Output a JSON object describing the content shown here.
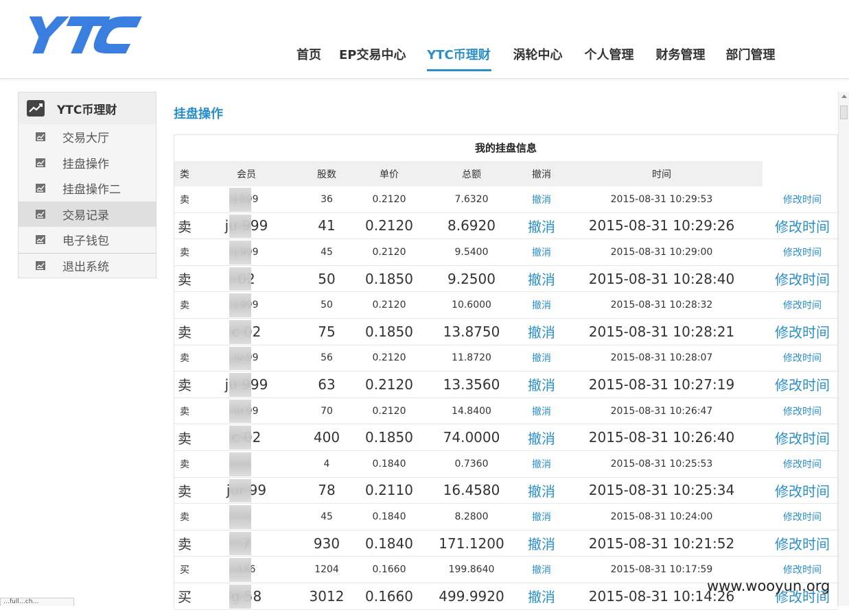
{
  "logo": {
    "text": "YTC"
  },
  "nav": [
    {
      "label": "首页",
      "active": false
    },
    {
      "label": "EP交易中心",
      "active": false
    },
    {
      "label": "YTC币理财",
      "active": true
    },
    {
      "label": "涡轮中心",
      "active": false
    },
    {
      "label": "个人管理",
      "active": false
    },
    {
      "label": "财务管理",
      "active": false
    },
    {
      "label": "部门管理",
      "active": false
    }
  ],
  "sidebar": {
    "title": "YTC币理财",
    "items": [
      {
        "label": "交易大厅"
      },
      {
        "label": "挂盘操作"
      },
      {
        "label": "挂盘操作二"
      },
      {
        "label": "交易记录"
      },
      {
        "label": "电子钱包"
      },
      {
        "label": "退出系统"
      }
    ]
  },
  "section_title": "挂盘操作",
  "table": {
    "caption": "我的挂盘信息",
    "headers": {
      "type": "类",
      "member": "会员",
      "shares": "股数",
      "price": "单价",
      "total": "总额",
      "cancel": "撤消",
      "time": "时间"
    },
    "rows": [
      {
        "type": "卖",
        "member": "j 999",
        "shares": "36",
        "price": "0.2120",
        "total": "7.6320",
        "cancel": "撤消",
        "time": "2015-08-31 10:29:53",
        "modify": "修改时间",
        "size": "small"
      },
      {
        "type": "卖",
        "member": "ju 999",
        "shares": "41",
        "price": "0.2120",
        "total": "8.6920",
        "cancel": "撤消",
        "time": "2015-08-31 10:29:26",
        "modify": "修改时间",
        "size": "big"
      },
      {
        "type": "卖",
        "member": "j 999",
        "shares": "45",
        "price": "0.2120",
        "total": "9.5400",
        "cancel": "撤消",
        "time": "2015-08-31 10:29:00",
        "modify": "修改时间",
        "size": "small"
      },
      {
        "type": "卖",
        "member": "02",
        "shares": "50",
        "price": "0.1850",
        "total": "9.2500",
        "cancel": "撤消",
        "time": "2015-08-31 10:28:40",
        "modify": "修改时间",
        "size": "big"
      },
      {
        "type": "卖",
        "member": "j 999",
        "shares": "50",
        "price": "0.2120",
        "total": "10.6000",
        "cancel": "撤消",
        "time": "2015-08-31 10:28:32",
        "modify": "修改时间",
        "size": "small"
      },
      {
        "type": "卖",
        "member": "c 02",
        "shares": "75",
        "price": "0.1850",
        "total": "13.8750",
        "cancel": "撤消",
        "time": "2015-08-31 10:28:21",
        "modify": "修改时间",
        "size": "big"
      },
      {
        "type": "卖",
        "member": "ju 99",
        "shares": "56",
        "price": "0.2120",
        "total": "11.8720",
        "cancel": "撤消",
        "time": "2015-08-31 10:28:07",
        "modify": "修改时间",
        "size": "small"
      },
      {
        "type": "卖",
        "member": "ju 999",
        "shares": "63",
        "price": "0.2120",
        "total": "13.3560",
        "cancel": "撤消",
        "time": "2015-08-31 10:27:19",
        "modify": "修改时间",
        "size": "big"
      },
      {
        "type": "卖",
        "member": "ju 99",
        "shares": "70",
        "price": "0.2120",
        "total": "14.8400",
        "cancel": "撤消",
        "time": "2015-08-31 10:26:47",
        "modify": "修改时间",
        "size": "small"
      },
      {
        "type": "卖",
        "member": "c 02",
        "shares": "400",
        "price": "0.1850",
        "total": "74.0000",
        "cancel": "撤消",
        "time": "2015-08-31 10:26:40",
        "modify": "修改时间",
        "size": "big"
      },
      {
        "type": "卖",
        "member": "",
        "shares": "4",
        "price": "0.1840",
        "total": "0.7360",
        "cancel": "撤消",
        "time": "2015-08-31 10:25:53",
        "modify": "修改时间",
        "size": "small"
      },
      {
        "type": "卖",
        "member": "jur 99",
        "shares": "78",
        "price": "0.2110",
        "total": "16.4580",
        "cancel": "撤消",
        "time": "2015-08-31 10:25:34",
        "modify": "修改时间",
        "size": "big"
      },
      {
        "type": "卖",
        "member": "",
        "shares": "45",
        "price": "0.1840",
        "total": "8.2800",
        "cancel": "撤消",
        "time": "2015-08-31 10:24:00",
        "modify": "修改时间",
        "size": "small"
      },
      {
        "type": "卖",
        "member": "7",
        "shares": "930",
        "price": "0.1840",
        "total": "171.1200",
        "cancel": "撤消",
        "time": "2015-08-31 10:21:52",
        "modify": "修改时间",
        "size": "big"
      },
      {
        "type": "买",
        "member": "186",
        "shares": "1204",
        "price": "0.1660",
        "total": "199.8640",
        "cancel": "撤消",
        "time": "2015-08-31 10:17:59",
        "modify": "修改时间",
        "size": "small"
      },
      {
        "type": "买",
        "member": "g 58",
        "shares": "3012",
        "price": "0.1660",
        "total": "499.9920",
        "cancel": "撤消",
        "time": "2015-08-31 10:14:26",
        "modify": "修改时间",
        "size": "big"
      }
    ]
  },
  "watermark": "www.wooyun.org",
  "status_stub": "…full…ch…",
  "colors": {
    "accent": "#2a8fc9",
    "logo": "#3a7fe0"
  }
}
